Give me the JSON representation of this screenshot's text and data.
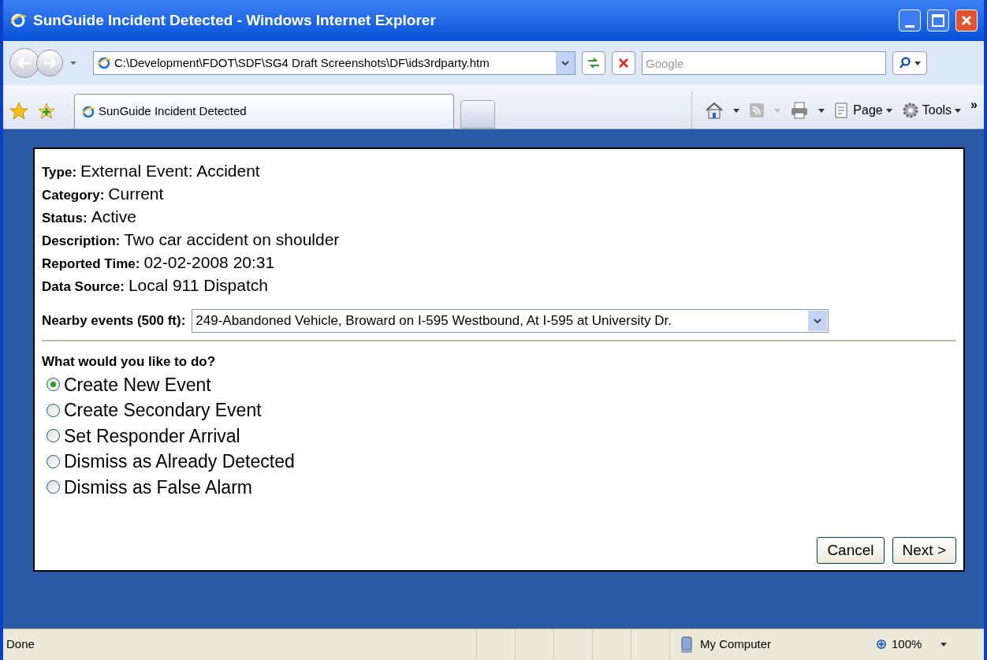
{
  "window": {
    "title": "SunGuide Incident Detected - Windows Internet Explorer"
  },
  "address_bar": {
    "value": "C:\\Development\\FDOT\\SDF\\SG4 Draft Screenshots\\DF\\ids3rdparty.htm"
  },
  "search": {
    "placeholder": "Google"
  },
  "tabs": [
    {
      "label": "SunGuide Incident Detected",
      "selected": true
    }
  ],
  "command_bar": [
    {
      "label": "Page"
    },
    {
      "label": "Tools"
    }
  ],
  "chevron": "»",
  "details": [
    {
      "label": "Type:",
      "value": "External Event: Accident"
    },
    {
      "label": "Category:",
      "value": "Current"
    },
    {
      "label": "Status:",
      "value": "Active"
    },
    {
      "label": "Description:",
      "value": "Two car accident on shoulder"
    },
    {
      "label": "Reported Time:",
      "value": "02-02-2008 20:31"
    },
    {
      "label": "Data Source:",
      "value": "Local 911 Dispatch"
    }
  ],
  "nearby": {
    "label": "Nearby events (500 ft):",
    "value": "249-Abandoned Vehicle, Broward on I-595 Westbound, At I-595 at University Dr."
  },
  "question": "What would you like to do?",
  "options": [
    {
      "label": "Create New Event",
      "selected": true
    },
    {
      "label": "Create Secondary Event",
      "selected": false
    },
    {
      "label": "Set Responder Arrival",
      "selected": false
    },
    {
      "label": "Dismiss as Already Detected",
      "selected": false
    },
    {
      "label": "Dismiss as False Alarm",
      "selected": false
    }
  ],
  "buttons": [
    "Cancel",
    "Next >"
  ],
  "status_bar": {
    "text": "Done",
    "zone": "My Computer",
    "zoom": "100%"
  }
}
